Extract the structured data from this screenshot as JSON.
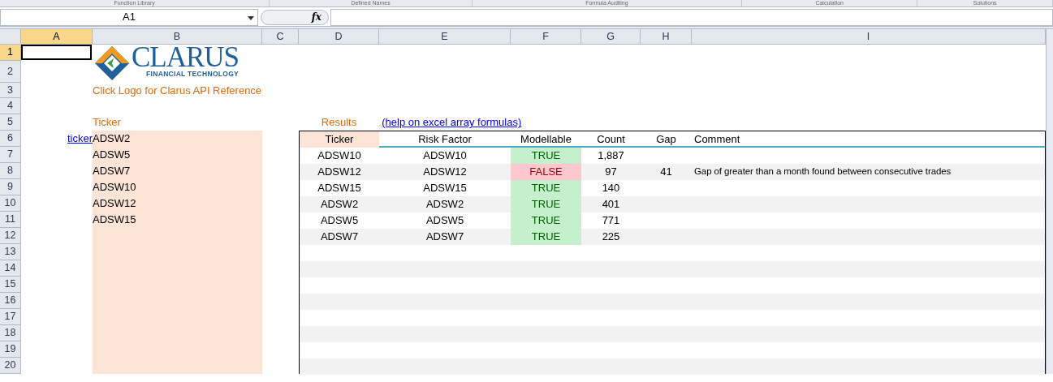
{
  "ribbon_groups": [
    "Function Library",
    "Defined Names",
    "Formula Auditing",
    "Calculation",
    "Solutions"
  ],
  "name_box": "A1",
  "formula_icon": "fx",
  "columns": [
    {
      "label": "A",
      "selected": true
    },
    {
      "label": "B",
      "selected": false
    },
    {
      "label": "C",
      "selected": false
    },
    {
      "label": "D",
      "selected": false
    },
    {
      "label": "E",
      "selected": false
    },
    {
      "label": "F",
      "selected": false
    },
    {
      "label": "G",
      "selected": false
    },
    {
      "label": "H",
      "selected": false
    },
    {
      "label": "I",
      "selected": false
    }
  ],
  "rows": [
    {
      "label": "1",
      "selected": true
    },
    {
      "label": "2",
      "selected": false
    },
    {
      "label": "3",
      "selected": false
    },
    {
      "label": "4",
      "selected": false
    },
    {
      "label": "5",
      "selected": false
    },
    {
      "label": "6",
      "selected": false
    },
    {
      "label": "7",
      "selected": false
    },
    {
      "label": "8",
      "selected": false
    },
    {
      "label": "9",
      "selected": false
    },
    {
      "label": "10",
      "selected": false
    },
    {
      "label": "11",
      "selected": false
    },
    {
      "label": "12",
      "selected": false
    },
    {
      "label": "13",
      "selected": false
    },
    {
      "label": "14",
      "selected": false
    },
    {
      "label": "15",
      "selected": false
    },
    {
      "label": "16",
      "selected": false
    },
    {
      "label": "17",
      "selected": false
    },
    {
      "label": "18",
      "selected": false
    },
    {
      "label": "19",
      "selected": false
    },
    {
      "label": "20",
      "selected": false
    }
  ],
  "logo": {
    "name": "CLARUS",
    "tagline": "FINANCIAL TECHNOLOGY"
  },
  "logo_caption": "Click Logo for Clarus API Reference",
  "tickers": {
    "label": "Ticker",
    "link": "ticker",
    "values": [
      "ADSW2",
      "ADSW5",
      "ADSW7",
      "ADSW10",
      "ADSW12",
      "ADSW15"
    ]
  },
  "results": {
    "label": "Results",
    "help_link": "(help on excel array formulas)",
    "columns": [
      "Ticker",
      "Risk Factor",
      "Modellable",
      "Count",
      "Gap",
      "Comment"
    ],
    "rows": [
      {
        "ticker": "ADSW10",
        "risk_factor": "ADSW10",
        "modellable": "TRUE",
        "passed": true,
        "count": "1,887"
      },
      {
        "ticker": "ADSW12",
        "risk_factor": "ADSW12",
        "modellable": "FALSE",
        "passed": false,
        "count": "97",
        "gap": "41",
        "comment": "Gap of greater than a month found between consecutive trades"
      },
      {
        "ticker": "ADSW15",
        "risk_factor": "ADSW15",
        "modellable": "TRUE",
        "passed": true,
        "count": "140"
      },
      {
        "ticker": "ADSW2",
        "risk_factor": "ADSW2",
        "modellable": "TRUE",
        "passed": true,
        "count": "401"
      },
      {
        "ticker": "ADSW5",
        "risk_factor": "ADSW5",
        "modellable": "TRUE",
        "passed": true,
        "count": "771"
      },
      {
        "ticker": "ADSW7",
        "risk_factor": "ADSW7",
        "modellable": "TRUE",
        "passed": true,
        "count": "225"
      }
    ]
  }
}
